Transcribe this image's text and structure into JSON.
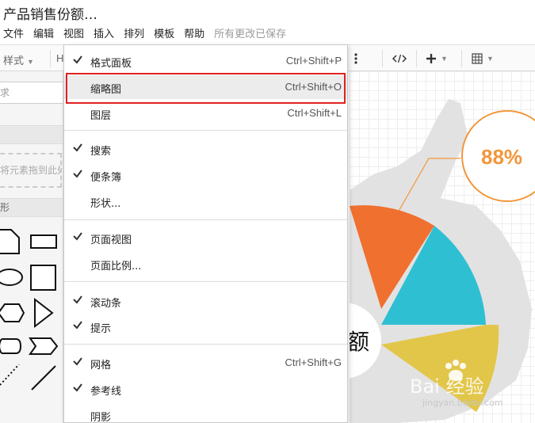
{
  "app": {
    "title": "产品销售份额…"
  },
  "menubar": {
    "items": [
      "文件",
      "编辑",
      "视图",
      "插入",
      "排列",
      "模板",
      "帮助"
    ],
    "save_status": "所有更改已保存"
  },
  "toolbar": {
    "style_label": "样式",
    "format_label": "H"
  },
  "sidebar": {
    "search_placeholder": "求",
    "drop_hint": "将元素拖到此处",
    "shapes_section_label": "形"
  },
  "view_menu": {
    "items": [
      {
        "label": "格式面板",
        "shortcut": "Ctrl+Shift+P",
        "checked": true
      },
      {
        "label": "缩略图",
        "shortcut": "Ctrl+Shift+O",
        "checked": false
      },
      {
        "label": "图层",
        "shortcut": "Ctrl+Shift+L",
        "checked": false
      },
      {
        "label": "搜索",
        "shortcut": "",
        "checked": true
      },
      {
        "label": "便条簿",
        "shortcut": "",
        "checked": true
      },
      {
        "label": "形状...",
        "shortcut": "",
        "checked": false
      },
      {
        "label": "页面视图",
        "shortcut": "",
        "checked": true
      },
      {
        "label": "页面比例...",
        "shortcut": "",
        "checked": false
      },
      {
        "label": "滚动条",
        "shortcut": "",
        "checked": true
      },
      {
        "label": "提示",
        "shortcut": "",
        "checked": true
      },
      {
        "label": "网格",
        "shortcut": "Ctrl+Shift+G",
        "checked": true
      },
      {
        "label": "参考线",
        "shortcut": "",
        "checked": true
      },
      {
        "label": "阴影",
        "shortcut": "",
        "checked": false
      }
    ]
  },
  "canvas": {
    "percent_label": "88%",
    "center_label": "额",
    "watermark_brand": "Bai 经验",
    "watermark_url": "jingyan.baidu.com"
  },
  "colors": {
    "orange": "#f07030",
    "teal": "#2fbfd2",
    "yellow": "#e2c64a",
    "percent": "#f3963a",
    "highlight_border": "#e02020"
  },
  "icons": [
    "check-icon",
    "more-icon",
    "code-icon",
    "plus-icon",
    "table-icon",
    "chevron-down-icon"
  ]
}
